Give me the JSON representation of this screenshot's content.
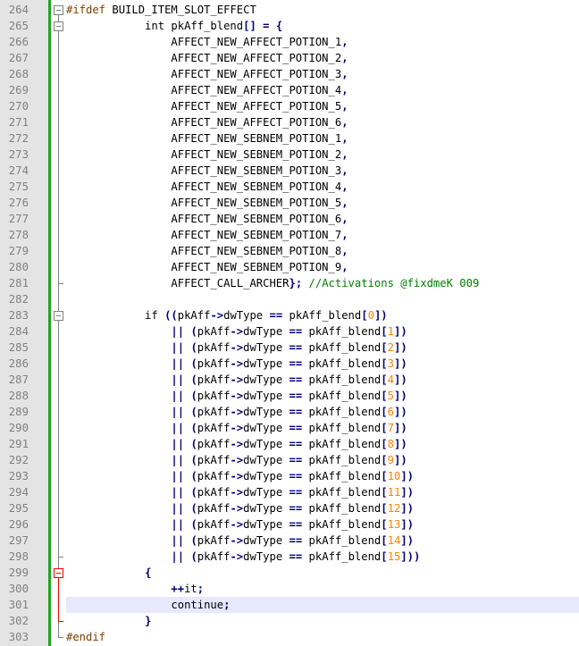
{
  "editor": {
    "lines": [
      {
        "number": "264",
        "code": "#ifdef BUILD_ITEM_SLOT_EFFECT"
      },
      {
        "number": "265",
        "code": "            int pkAff_blend[] = {"
      },
      {
        "number": "266",
        "code": "                AFFECT_NEW_AFFECT_POTION_1,"
      },
      {
        "number": "267",
        "code": "                AFFECT_NEW_AFFECT_POTION_2,"
      },
      {
        "number": "268",
        "code": "                AFFECT_NEW_AFFECT_POTION_3,"
      },
      {
        "number": "269",
        "code": "                AFFECT_NEW_AFFECT_POTION_4,"
      },
      {
        "number": "270",
        "code": "                AFFECT_NEW_AFFECT_POTION_5,"
      },
      {
        "number": "271",
        "code": "                AFFECT_NEW_AFFECT_POTION_6,"
      },
      {
        "number": "272",
        "code": "                AFFECT_NEW_SEBNEM_POTION_1,"
      },
      {
        "number": "273",
        "code": "                AFFECT_NEW_SEBNEM_POTION_2,"
      },
      {
        "number": "274",
        "code": "                AFFECT_NEW_SEBNEM_POTION_3,"
      },
      {
        "number": "275",
        "code": "                AFFECT_NEW_SEBNEM_POTION_4,"
      },
      {
        "number": "276",
        "code": "                AFFECT_NEW_SEBNEM_POTION_5,"
      },
      {
        "number": "277",
        "code": "                AFFECT_NEW_SEBNEM_POTION_6,"
      },
      {
        "number": "278",
        "code": "                AFFECT_NEW_SEBNEM_POTION_7,"
      },
      {
        "number": "279",
        "code": "                AFFECT_NEW_SEBNEM_POTION_8,"
      },
      {
        "number": "280",
        "code": "                AFFECT_NEW_SEBNEM_POTION_9,"
      },
      {
        "number": "281",
        "code": "                AFFECT_CALL_ARCHER}; //Activations @fixdmeK 009"
      },
      {
        "number": "282",
        "code": ""
      },
      {
        "number": "283",
        "code": "            if ((pkAff->dwType == pkAff_blend[0])"
      },
      {
        "number": "284",
        "code": "                || (pkAff->dwType == pkAff_blend[1])"
      },
      {
        "number": "285",
        "code": "                || (pkAff->dwType == pkAff_blend[2])"
      },
      {
        "number": "286",
        "code": "                || (pkAff->dwType == pkAff_blend[3])"
      },
      {
        "number": "287",
        "code": "                || (pkAff->dwType == pkAff_blend[4])"
      },
      {
        "number": "288",
        "code": "                || (pkAff->dwType == pkAff_blend[5])"
      },
      {
        "number": "289",
        "code": "                || (pkAff->dwType == pkAff_blend[6])"
      },
      {
        "number": "290",
        "code": "                || (pkAff->dwType == pkAff_blend[7])"
      },
      {
        "number": "291",
        "code": "                || (pkAff->dwType == pkAff_blend[8])"
      },
      {
        "number": "292",
        "code": "                || (pkAff->dwType == pkAff_blend[9])"
      },
      {
        "number": "293",
        "code": "                || (pkAff->dwType == pkAff_blend[10])"
      },
      {
        "number": "294",
        "code": "                || (pkAff->dwType == pkAff_blend[11])"
      },
      {
        "number": "295",
        "code": "                || (pkAff->dwType == pkAff_blend[12])"
      },
      {
        "number": "296",
        "code": "                || (pkAff->dwType == pkAff_blend[13])"
      },
      {
        "number": "297",
        "code": "                || (pkAff->dwType == pkAff_blend[14])"
      },
      {
        "number": "298",
        "code": "                || (pkAff->dwType == pkAff_blend[15]))"
      },
      {
        "number": "299",
        "code": "            {"
      },
      {
        "number": "300",
        "code": "                ++it;"
      },
      {
        "number": "301",
        "code": "                continue;"
      },
      {
        "number": "302",
        "code": "            }"
      },
      {
        "number": "303",
        "code": "#endif"
      }
    ],
    "current_line": "301",
    "colors": {
      "gutter_bg": "#e4e4e4",
      "line_number": "#808080",
      "change_bar": "#1fa51f",
      "keyword": "#0000ff",
      "type_keyword": "#8000ff",
      "number": "#ff8000",
      "operator": "#000080",
      "comment": "#008000",
      "preprocessor": "#804000",
      "current_line_bg": "#e8e8ff",
      "fold_active": "#ff0000"
    }
  }
}
